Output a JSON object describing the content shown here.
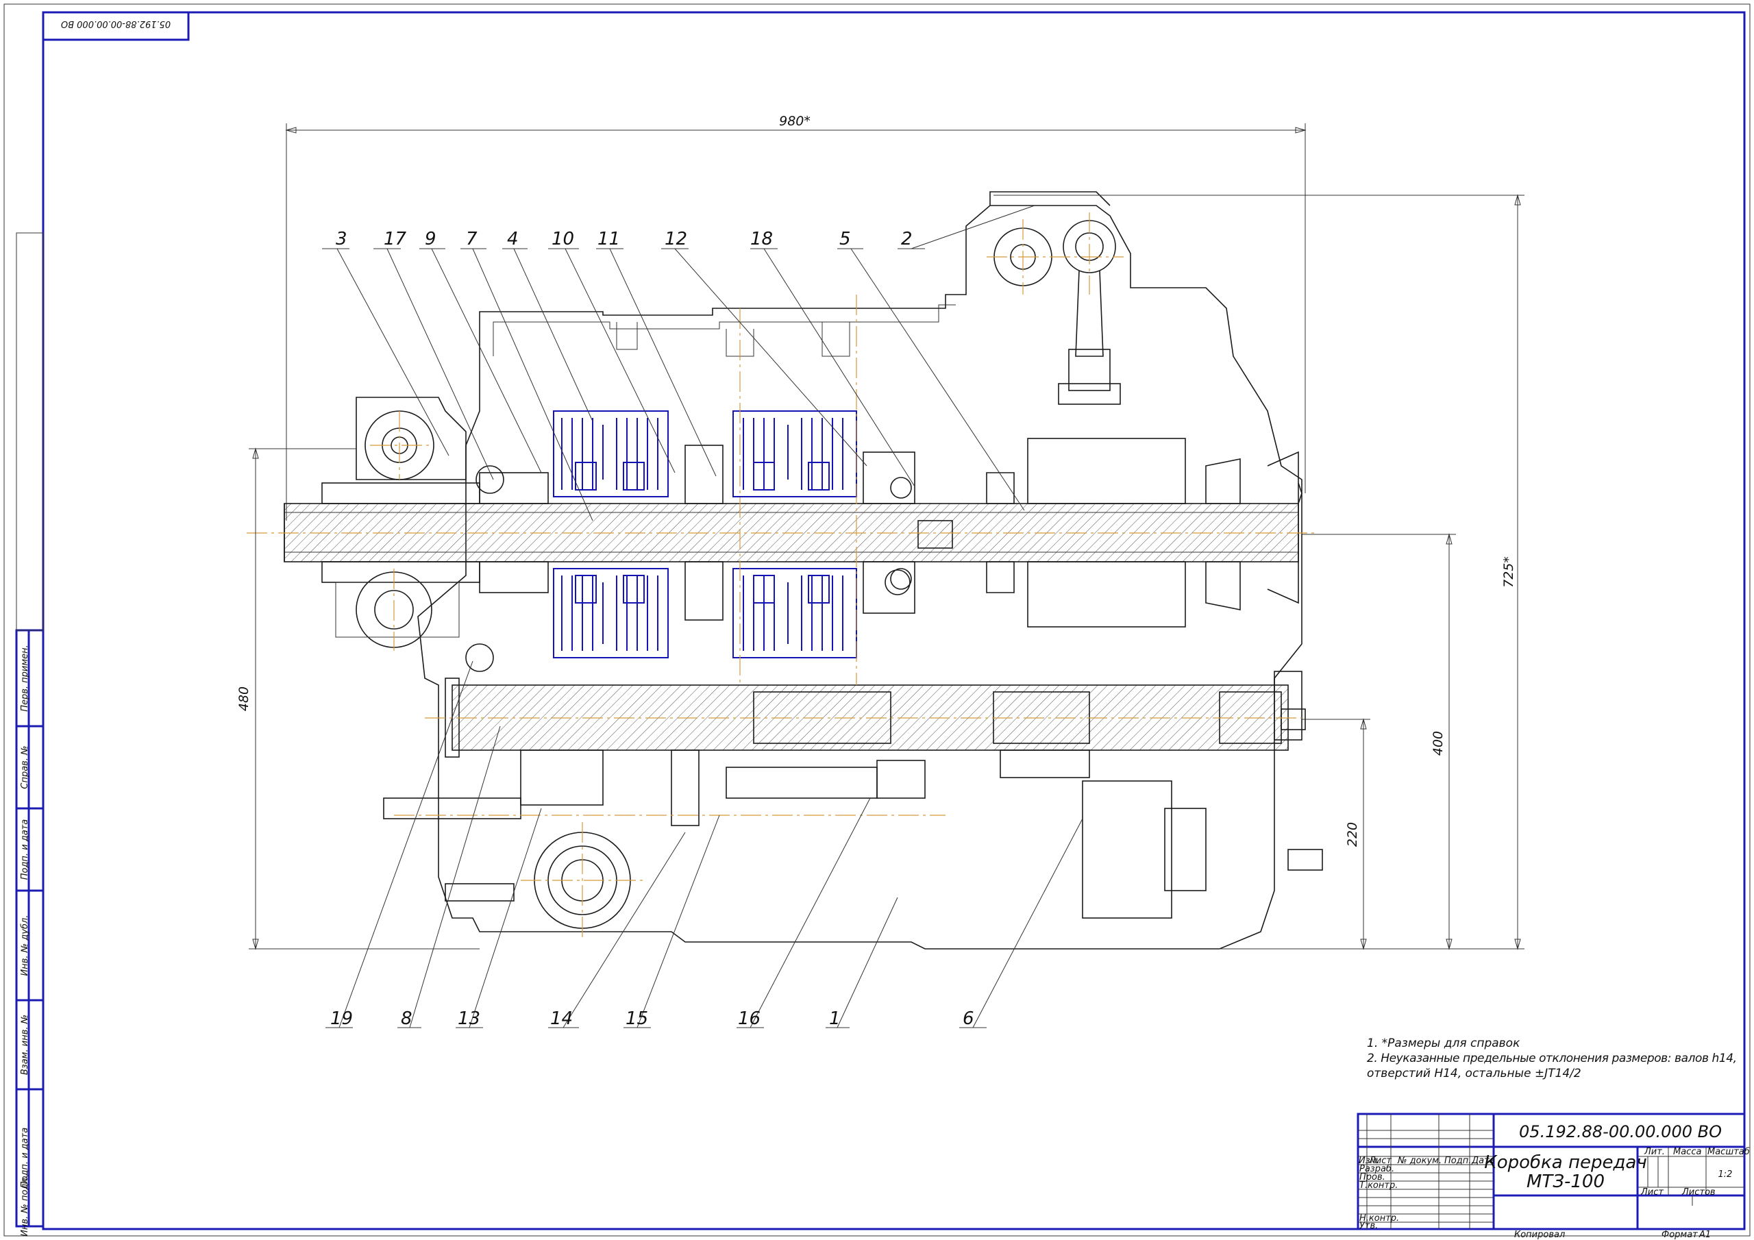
{
  "stamp_code": "05.192.88-00.00.000 ВО",
  "dimensions": {
    "d980": "980*",
    "d725": "725*",
    "d480": "480",
    "d400": "400",
    "d220": "220"
  },
  "callouts_top": [
    "3",
    "17",
    "9",
    "7",
    "4",
    "10",
    "11",
    "12",
    "18",
    "5",
    "2"
  ],
  "callouts_bottom": [
    "19",
    "8",
    "13",
    "14",
    "15",
    "16",
    "1",
    "6"
  ],
  "notes": [
    "1. *Размеры для справок",
    "2. Неуказанные предельные отклонения размеров: валов h14,",
    "отверстий H14, остальные ±JT14/2"
  ],
  "title_block": {
    "code": "05.192.88-00.00.000 ВО",
    "name_line1": "Коробка передач",
    "name_line2": "МТЗ-100",
    "col_izm": "Изм.",
    "col_list": "Лист",
    "col_doc": "№ докум.",
    "col_sign": "Подп.",
    "col_date": "Дата",
    "row_razrab": "Разраб.",
    "row_prov": "Пров.",
    "row_tkontr": "Т.контр.",
    "row_nkontr": "Н.контр.",
    "row_utv": "Утв.",
    "lit": "Лит.",
    "massa": "Масса",
    "masshtab": "Масштаб",
    "scale_value": "1:2",
    "sheet": "Лист",
    "sheets": "Листов",
    "copied": "Копировал",
    "format": "Формат",
    "format_value": "A1"
  },
  "side_stamps": [
    "Перв. примен.",
    "Справ. №",
    "Подп. и дата",
    "Инв. № дубл.",
    "Взам. инв. №",
    "Подп. и дата",
    "Инв. № подл."
  ],
  "colors": {
    "frame": "#1c1cb4",
    "clutch": "#1414b4",
    "axis": "#d59a3a",
    "line": "#1a1a1a"
  }
}
